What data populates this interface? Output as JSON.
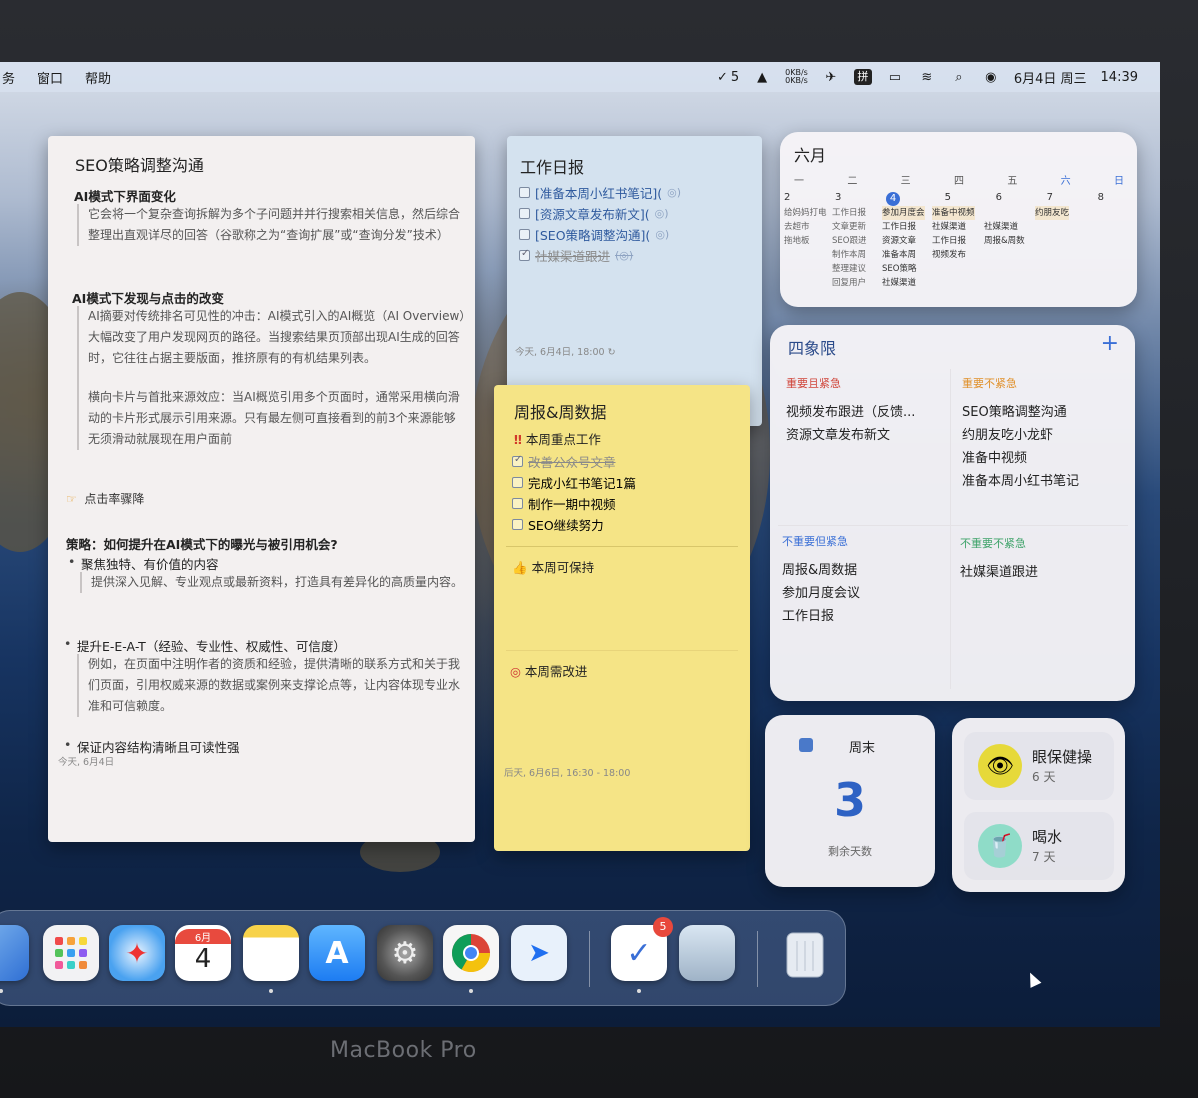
{
  "menubar": {
    "left_items": [
      "务",
      "窗口",
      "帮助"
    ],
    "tasks_count": "5",
    "net_up": "0KB/s",
    "net_down": "0KB/s",
    "input_method": "拼",
    "date_label": "6月4日 周三",
    "time_label": "14:39"
  },
  "note_seo": {
    "title": "SEO策略调整沟通",
    "section1_heading": "AI模式下界面变化",
    "section1_text": "它会将一个复杂查询拆解为多个子问题并并行搜索相关信息，然后综合整理出直观详尽的回答（谷歌称之为“查询扩展”或“查询分发”技术）",
    "section2_heading": "AI模式下发现与点击的改变",
    "section2_text_a": "AI摘要对传统排名可见性的冲击：AI模式引入的AI概览（AI Overview）大幅改变了用户发现网页的路径。当搜索结果页顶部出现AI生成的回答时，它往往占据主要版面，推挤原有的有机结果列表。",
    "section2_text_b": "横向卡片与首批来源效应：当AI概览引用多个页面时，通常采用横向滑动的卡片形式展示引用来源。只有最左侧可直接看到的前3个来源能够无须滑动就展现在用户面前",
    "pointer_line": "点击率骤降",
    "strategy_heading": "策略：如何提升在AI模式下的曝光与被引用机会?",
    "bullet1_heading": "聚焦独特、有价值的内容",
    "bullet1_text": "提供深入见解、专业观点或最新资料，打造具有差异化的高质量内容。",
    "bullet2_heading": "提升E-E-A-T（经验、专业性、权威性、可信度）",
    "bullet2_text": "例如，在页面中注明作者的资质和经验，提供清晰的联系方式和关于我们页面，引用权威来源的数据或案例来支撑论点等，让内容体现专业水准和可信赖度。",
    "bullet3_heading": "保证内容结构清晰且可读性强",
    "footer": "今天, 6月4日"
  },
  "note_work": {
    "title": "工作日报",
    "tasks": [
      {
        "label": "[准备本周小红书笔记](",
        "tag": "◎)",
        "checked": false
      },
      {
        "label": "[资源文章发布新文](",
        "tag": "◎)",
        "checked": false
      },
      {
        "label": "[SEO策略调整沟通](",
        "tag": "◎)",
        "checked": false
      },
      {
        "label": "社媒渠道跟进",
        "tag": "(◎)",
        "checked": true
      }
    ],
    "footer": "今天, 6月4日, 18:00"
  },
  "note_weekly": {
    "title": "周报&周数据",
    "focus_heading": "本周重点工作",
    "tasks": [
      {
        "label": "改善公众号文章",
        "checked": true
      },
      {
        "label": "完成小红书笔记1篇",
        "checked": false
      },
      {
        "label": "制作一期中视频",
        "checked": false
      },
      {
        "label": "SEO继续努力",
        "checked": false
      }
    ],
    "keep_heading": "本周可保持",
    "improve_heading": "本周需改进",
    "footer": "后天, 6月6日, 16:30 - 18:00"
  },
  "calendar": {
    "title": "六月",
    "weekdays": [
      "一",
      "二",
      "三",
      "四",
      "五",
      "六",
      "日"
    ],
    "dates": [
      "2",
      "3",
      "4",
      "5",
      "6",
      "7",
      "8"
    ],
    "today": "4",
    "events_col1": [
      "给妈妈打电",
      "去超市",
      "拖地板"
    ],
    "events_col2": [
      "工作日报",
      "文章更新",
      "SEO跟进",
      "制作本周",
      "整理建议",
      "回复用户"
    ],
    "events_col3": [
      "参加月度会",
      "工作日报",
      "资源文章",
      "准备本周",
      "SEO策略",
      "社媒渠道"
    ],
    "events_col4": [
      "准备中视频",
      "社媒渠道",
      "工作日报",
      "视频发布"
    ],
    "events_col5": [
      "社媒渠道",
      "周报&周数"
    ],
    "events_col7": [
      "约朋友吃"
    ]
  },
  "quadrant": {
    "title": "四象限",
    "q1": {
      "label": "重要且紧急",
      "color": "#d0453a",
      "items": [
        "视频发布跟进（反馈...",
        "资源文章发布新文"
      ]
    },
    "q2": {
      "label": "重要不紧急",
      "color": "#e0902a",
      "items": [
        "SEO策略调整沟通",
        "约朋友吃小龙虾",
        "准备中视频",
        "准备本周小红书笔记"
      ]
    },
    "q3": {
      "label": "不重要但紧急",
      "color": "#3a6fd6",
      "items": [
        "周报&周数据",
        "参加月度会议",
        "工作日报"
      ]
    },
    "q4": {
      "label": "不重要不紧急",
      "color": "#3fa36a",
      "items": [
        "社媒渠道跟进"
      ]
    }
  },
  "weekend": {
    "title": "周末",
    "count": "3",
    "subtitle": "剩余天数"
  },
  "health": {
    "items": [
      {
        "name": "眼保健操",
        "days": "6 天",
        "icon": "eye-icon",
        "color": "#e6d93a"
      },
      {
        "name": "喝水",
        "days": "7 天",
        "icon": "water-cup-icon",
        "color": "#8fdcc8"
      }
    ]
  },
  "dock": {
    "calendar_month": "6月",
    "calendar_day": "4",
    "tasks_badge": "5"
  },
  "device": {
    "brand": "MacBook Pro"
  }
}
